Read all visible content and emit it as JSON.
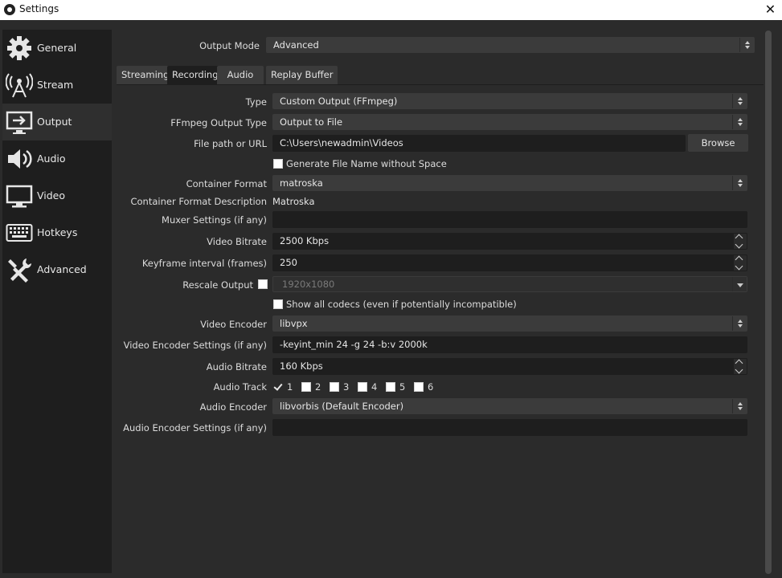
{
  "window": {
    "title": "Settings"
  },
  "sidebar": {
    "items": [
      {
        "label": "General",
        "icon": "gear-icon"
      },
      {
        "label": "Stream",
        "icon": "antenna-icon"
      },
      {
        "label": "Output",
        "icon": "output-icon"
      },
      {
        "label": "Audio",
        "icon": "speaker-icon"
      },
      {
        "label": "Video",
        "icon": "monitor-icon"
      },
      {
        "label": "Hotkeys",
        "icon": "keyboard-icon"
      },
      {
        "label": "Advanced",
        "icon": "tools-icon"
      }
    ],
    "selected": "Output"
  },
  "output_mode": {
    "label": "Output Mode",
    "value": "Advanced"
  },
  "tabs": [
    "Streaming",
    "Recording",
    "Audio",
    "Replay Buffer"
  ],
  "active_tab": "Recording",
  "recording": {
    "type": {
      "label": "Type",
      "value": "Custom Output (FFmpeg)"
    },
    "ffmpeg_output_type": {
      "label": "FFmpeg Output Type",
      "value": "Output to File"
    },
    "file_path": {
      "label": "File path or URL",
      "value": "C:\\Users\\newadmin\\Videos",
      "browse_label": "Browse"
    },
    "generate_file_name": {
      "label": "Generate File Name without Space",
      "checked": false
    },
    "container_format": {
      "label": "Container Format",
      "value": "matroska"
    },
    "container_format_description": {
      "label": "Container Format Description",
      "value": "Matroska"
    },
    "muxer_settings": {
      "label": "Muxer Settings (if any)",
      "value": ""
    },
    "video_bitrate": {
      "label": "Video Bitrate",
      "value": "2500 Kbps"
    },
    "keyframe_interval": {
      "label": "Keyframe interval (frames)",
      "value": "250"
    },
    "rescale_output": {
      "label": "Rescale Output",
      "checked": false,
      "value": "1920x1080"
    },
    "show_all_codecs": {
      "label": "Show all codecs (even if potentially incompatible)",
      "checked": false
    },
    "video_encoder": {
      "label": "Video Encoder",
      "value": "libvpx"
    },
    "video_encoder_settings": {
      "label": "Video Encoder Settings (if any)",
      "value": "-keyint_min 24 -g 24 -b:v 2000k"
    },
    "audio_bitrate": {
      "label": "Audio Bitrate",
      "value": "160 Kbps"
    },
    "audio_track": {
      "label": "Audio Track",
      "tracks": [
        {
          "label": "1",
          "checked": true
        },
        {
          "label": "2",
          "checked": false
        },
        {
          "label": "3",
          "checked": false
        },
        {
          "label": "4",
          "checked": false
        },
        {
          "label": "5",
          "checked": false
        },
        {
          "label": "6",
          "checked": false
        }
      ]
    },
    "audio_encoder": {
      "label": "Audio Encoder",
      "value": "libvorbis (Default Encoder)"
    },
    "audio_encoder_settings": {
      "label": "Audio Encoder Settings (if any)",
      "value": ""
    }
  }
}
